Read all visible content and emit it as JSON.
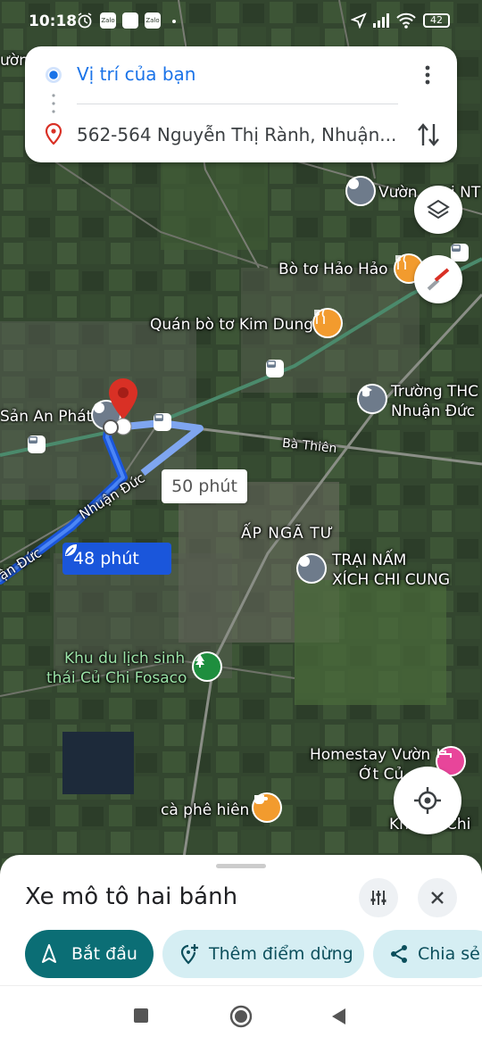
{
  "status_bar": {
    "time": "10:18",
    "battery": "42",
    "notif_icons": [
      "alarm-icon",
      "zalo-icon",
      "app-icon",
      "zalo-icon"
    ]
  },
  "directions": {
    "origin": "Vị trí của bạn",
    "destination": "562-564 Nguyễn Thị Rành, Nhuận...",
    "more_icon": "more-vert-icon",
    "swap_icon": "swap-icon"
  },
  "map": {
    "labels": {
      "top_left": "ườn",
      "vuon": "Vườn",
      "vuon_tail": "i NT",
      "bo_to_hao_hao": "Bò tơ Hảo Hảo",
      "quan_bo_to": "Quán bò tơ Kim Dung",
      "truong_line1": "Trường THC",
      "truong_line2": "Nhuận Đức",
      "san_an_phat": "Sản An Phát",
      "ba_thien": "Bà Thiên",
      "ap_nga_tu": "ẤP NGÃ TƯ",
      "trai_nam_1": "TRẠI NẤM",
      "trai_nam_2": "XÍCH CHI CUNG",
      "nhuan_duc_road": "Nhuận Đức",
      "duc_road": "ận Đức",
      "khu_du_lich_1": "Khu du lịch sinh",
      "khu_du_lich_2": "thái Củ Chi Fosaco",
      "homestay_1": "Homestay Vườn",
      "homestay_2": "Ớt Củ",
      "ca_phe": "cà phê hiên",
      "khu_chi": "Kh",
      "khu_chi_tail": "Chi"
    },
    "route_primary_time": "48 phút",
    "route_alt_time": "50 phút",
    "colors": {
      "route_primary": "#1a56db",
      "route_alt": "#7fa6f0",
      "pin_red": "#d93025"
    }
  },
  "buttons": {
    "layers_icon": "layers-icon",
    "compass_icon": "compass-icon",
    "locate_icon": "my-location-icon"
  },
  "sheet": {
    "mode_title": "Xe mô tô hai bánh",
    "options_icon": "tune-icon",
    "close_icon": "close-icon",
    "start_label": "Bắt đầu",
    "add_stop_label": "Thêm điểm dừng",
    "share_label": "Chia sẻ"
  },
  "navbar": {
    "recent_icon": "recent-apps-icon",
    "home_icon": "home-icon",
    "back_icon": "back-icon"
  }
}
